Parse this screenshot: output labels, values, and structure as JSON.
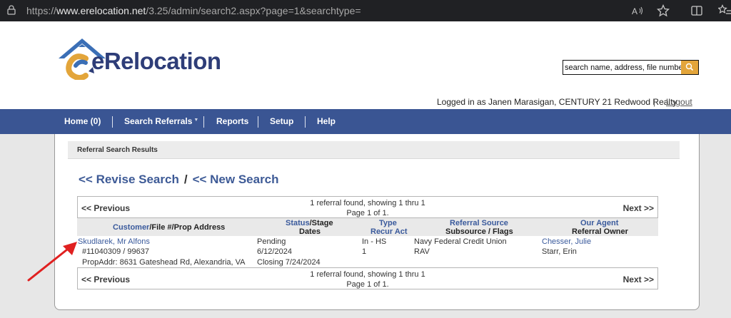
{
  "browser": {
    "url_prefix": "https://",
    "url_domain": "www.erelocation.net",
    "url_path": "/3.25/admin/search2.aspx?page=1&searchtype="
  },
  "header": {
    "logo_text": "eRelocation",
    "search_placeholder": "search name, address, file number",
    "logged_in_text": "Logged in as Janen Marasigan, CENTURY 21 Redwood Realty",
    "separator": "|",
    "logout_label": "Logout"
  },
  "nav": {
    "items": [
      {
        "label": "Home (0)"
      },
      {
        "label": "Search Referrals"
      },
      {
        "label": "Reports"
      },
      {
        "label": "Setup"
      },
      {
        "label": "Help"
      }
    ],
    "caret": "▼"
  },
  "results": {
    "section_title": "Referral Search Results",
    "revise_label": "<< Revise Search",
    "slash": "/",
    "new_search_label": "<< New Search",
    "pager": {
      "prev_label": "<< Previous",
      "next_label": "Next >>",
      "found_text": "1 referral found, showing 1 thru 1",
      "page_text": "Page 1 of 1."
    },
    "columns": {
      "customer_link": "Customer",
      "customer_rest": "/File #/Prop Address",
      "status_link": "Status",
      "status_rest": "/Stage",
      "dates": "Dates",
      "type_link": "Type",
      "recur_act": "Recur Act",
      "referral_source": "Referral Source",
      "subsource_flags": "Subsource / Flags",
      "our_agent": "Our Agent",
      "referral_owner": "Referral Owner"
    },
    "row": {
      "customer_name": "Skudlarek, Mr Alfons",
      "file_number": "#11040309 / 99637",
      "prop_address": "PropAddr: 8631 Gateshead Rd, Alexandria, VA",
      "status": "Pending",
      "date1": "6/12/2024",
      "closing": "Closing 7/24/2024",
      "type": "In - HS",
      "recur": "1",
      "source": "Navy Federal Credit Union",
      "subsource": "RAV",
      "agent": "Chesser, Julie",
      "owner": "Starr, Erin"
    }
  },
  "colors": {
    "nav_bg": "#3a5593",
    "link": "#3a5a9c",
    "accent": "#e3a53a",
    "annotation_arrow": "#e02020"
  }
}
